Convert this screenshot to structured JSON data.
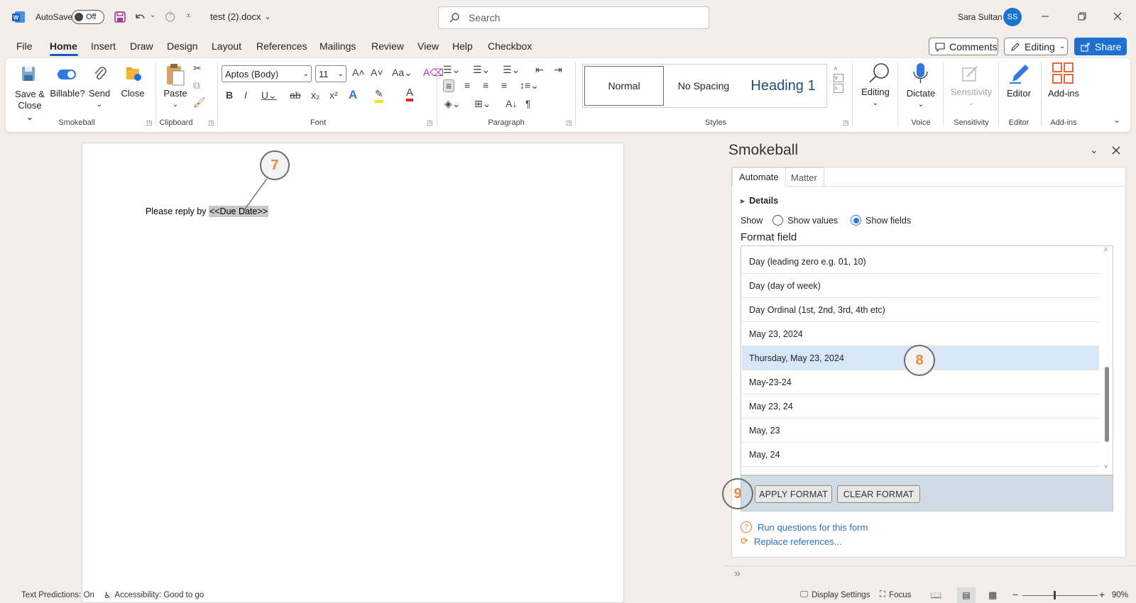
{
  "titlebar": {
    "autosave_label": "AutoSave",
    "autosave_state": "Off",
    "doc_title": "test (2).docx",
    "search_placeholder": "Search",
    "user_name": "Sara Sultan",
    "user_initials": "SS"
  },
  "menu": {
    "tabs": [
      "File",
      "Home",
      "Insert",
      "Draw",
      "Design",
      "Layout",
      "References",
      "Mailings",
      "Review",
      "View",
      "Help",
      "Checkbox"
    ],
    "active": "Home",
    "comments_label": "Comments",
    "editing_label": "Editing",
    "share_label": "Share"
  },
  "ribbon": {
    "smokeball": {
      "save_close": "Save &",
      "save_close2": "Close",
      "billable": "Billable?",
      "send": "Send",
      "close": "Close",
      "group": "Smokeball"
    },
    "clipboard": {
      "paste": "Paste",
      "group": "Clipboard"
    },
    "font": {
      "name": "Aptos (Body)",
      "size": "11",
      "group": "Font"
    },
    "paragraph": {
      "group": "Paragraph"
    },
    "styles": {
      "items": [
        "Normal",
        "No Spacing",
        "Heading 1"
      ],
      "group": "Styles"
    },
    "editing": {
      "label": "Editing"
    },
    "voice": {
      "dictate": "Dictate",
      "group": "Voice"
    },
    "sensitivity": {
      "label": "Sensitivity",
      "group": "Sensitivity"
    },
    "editor": {
      "label": "Editor",
      "group": "Editor"
    },
    "addins": {
      "label": "Add-ins",
      "group": "Add-ins"
    }
  },
  "document": {
    "text_prefix": "Please reply by ",
    "field": "<<Due Date>>",
    "callout_7": "7"
  },
  "pane": {
    "title": "Smokeball",
    "tabs": [
      "Automate",
      "Matter"
    ],
    "details": "Details",
    "show_label": "Show",
    "show_values": "Show values",
    "show_fields": "Show fields",
    "format_field": "Format field",
    "formats": [
      "Day (leading zero e.g. 01, 10)",
      "Day (day of week)",
      "Day Ordinal (1st, 2nd, 3rd, 4th etc)",
      "May 23, 2024",
      "Thursday, May 23, 2024",
      "May-23-24",
      "May 23, 24",
      "May, 23",
      "May, 24"
    ],
    "selected_index": 4,
    "callout_8": "8",
    "callout_9": "9",
    "apply": "APPLY FORMAT",
    "clear": "CLEAR FORMAT",
    "run_questions": "Run questions for this form",
    "replace_refs": "Replace references..."
  },
  "status": {
    "predictions": "Text Predictions: On",
    "accessibility": "Accessibility: Good to go",
    "display": "Display Settings",
    "focus": "Focus",
    "zoom": "90%"
  },
  "colors": {
    "accent": "#1874d0",
    "callout": "#f0883a",
    "selection": "#d7e7f7",
    "field_bg": "#c8c8c8"
  }
}
